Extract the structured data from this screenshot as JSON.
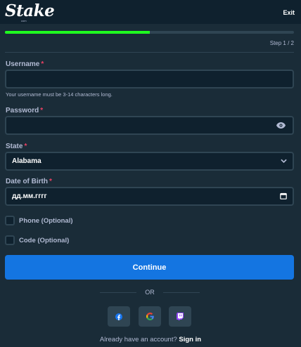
{
  "header": {
    "logo": "Stake",
    "logo_sub": "com",
    "exit": "Exit"
  },
  "progress": {
    "value": 0.5
  },
  "step": "Step 1 / 2",
  "form": {
    "username": {
      "label": "Username",
      "required": "*",
      "value": "",
      "hint": "Your username must be 3-14 characters long."
    },
    "password": {
      "label": "Password",
      "required": "*",
      "value": ""
    },
    "state": {
      "label": "State",
      "required": "*",
      "value": "Alabama"
    },
    "dob": {
      "label": "Date of Birth",
      "required": "*",
      "placeholder": "дд.мм.гггг"
    },
    "phone": {
      "label": "Phone (Optional)"
    },
    "code": {
      "label": "Code (Optional)"
    }
  },
  "continue": "Continue",
  "or": "OR",
  "social": [
    "facebook-icon",
    "google-icon",
    "twitch-icon"
  ],
  "footer": {
    "text": "Already have an account?",
    "link": "Sign in"
  },
  "colors": {
    "background": "#1a2c38",
    "header": "#0f212e",
    "progress": "#1fff20",
    "button": "#1475e1",
    "required": "#ed4163"
  }
}
